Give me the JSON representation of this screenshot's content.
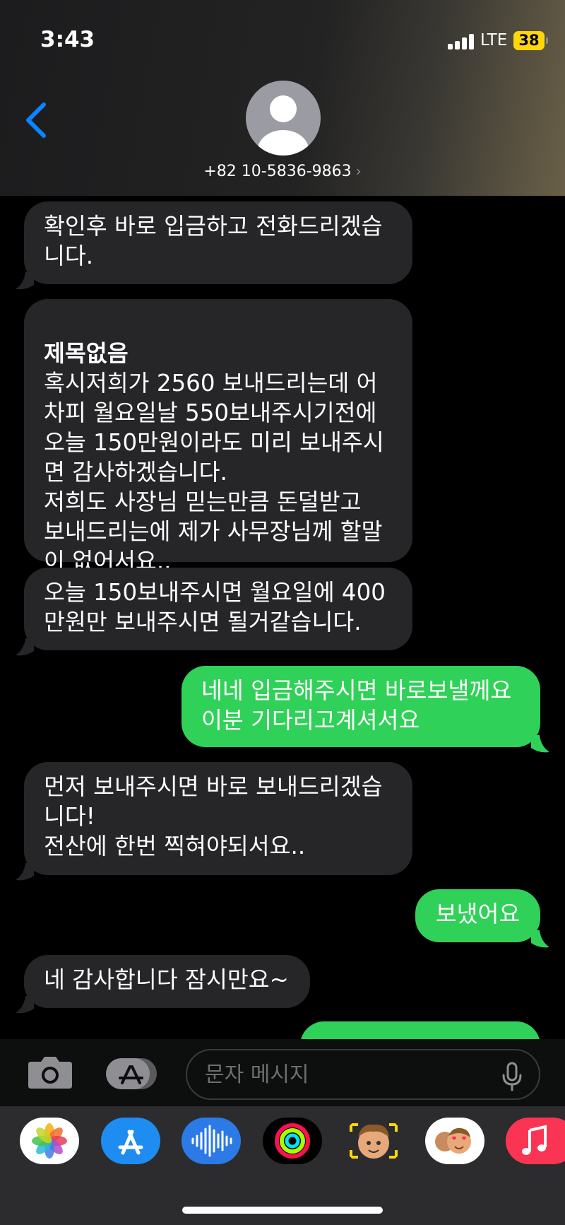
{
  "status_bar": {
    "time": "3:43",
    "network": "LTE",
    "battery": "38"
  },
  "header": {
    "contact_name": "+82 10-5836-9863",
    "chevron": "›"
  },
  "messages": [
    {
      "direction": "in",
      "text": "확인후 바로 입금하고 전화드리겠습\n니다."
    },
    {
      "direction": "in",
      "subject": "제목없음",
      "text": "혹시저희가 2560 보내드리는데 어\n차피 월요일날 550보내주시기전에\n오늘 150만원이라도 미리 보내주시\n면 감사하겠습니다.\n저희도 사장님 믿는만큼 돈덜받고\n보내드리는에 제가 사무장님께 할말\n이 없어서요.."
    },
    {
      "direction": "in",
      "text": "오늘 150보내주시면 월요일에 400\n만원만 보내주시면 될거같습니다."
    },
    {
      "direction": "out",
      "text": "네네 입금해주시면 바로보낼께요\n이분 기다리고계셔서요"
    },
    {
      "direction": "in",
      "text": "먼저 보내주시면 바로 보내드리겠습\n니다!\n전산에 한번 찍혀야되서요.."
    },
    {
      "direction": "out",
      "text": "보냈어요"
    },
    {
      "direction": "in",
      "text": "네 감사합니다 잠시만요~"
    },
    {
      "direction": "out",
      "text": ""
    }
  ],
  "input": {
    "placeholder": "문자 메시지"
  },
  "app_drawer": [
    "photos-icon",
    "app-store-icon",
    "voice-memos-icon",
    "activity-icon",
    "memoji-icon",
    "animoji-stickers-icon",
    "music-icon"
  ],
  "colors": {
    "outgoing": "#30d158",
    "incoming": "#262628",
    "accent": "#0a84ff"
  }
}
